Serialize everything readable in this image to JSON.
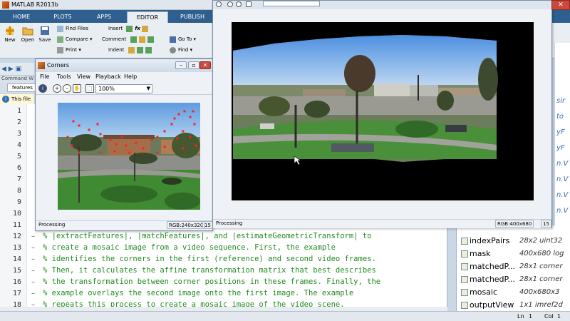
{
  "app": {
    "title": "MATLAB R2013b"
  },
  "tabs": [
    {
      "label": "HOME"
    },
    {
      "label": "PLOTS"
    },
    {
      "label": "APPS"
    },
    {
      "label": "EDITOR"
    },
    {
      "label": "PUBLISH"
    }
  ],
  "ribbon": {
    "new": "New",
    "open": "Open",
    "save": "Save",
    "find_files": "Find Files",
    "compare": "Compare",
    "print": "Print",
    "insert": "Insert",
    "comment": "Comment",
    "indent": "Indent",
    "go_to": "Go To",
    "find": "Find"
  },
  "left_panel": {
    "command_window_label": "Command W",
    "doc_tab": "features",
    "info_text": "This file c"
  },
  "editor": {
    "lines": [
      {
        "num": "1",
        "text": ""
      },
      {
        "num": "2",
        "text": ""
      },
      {
        "num": "3",
        "text": ""
      },
      {
        "num": "4",
        "text": ""
      },
      {
        "num": "5",
        "text": ""
      },
      {
        "num": "6",
        "text": ""
      },
      {
        "num": "7",
        "text": ""
      },
      {
        "num": "8",
        "text": ""
      },
      {
        "num": "9",
        "text": ""
      },
      {
        "num": "10",
        "text": ""
      },
      {
        "num": "11",
        "text": ""
      },
      {
        "num": "12",
        "text": "% |extractFeatures|, |matchFeatures|, and |estimateGeometricTransform| to"
      },
      {
        "num": "13",
        "text": "% create a mosaic image from a video sequence. First, the example"
      },
      {
        "num": "14",
        "text": "% identifies the corners in the first (reference) and second video frames."
      },
      {
        "num": "15",
        "text": "% Then, it calculates the affine transformation matrix that best describes"
      },
      {
        "num": "16",
        "text": "% the transformation between corner positions in these frames. Finally, the"
      },
      {
        "num": "17",
        "text": "% example overlays the second image onto the first image. The example"
      },
      {
        "num": "18",
        "text": "% repeats this process to create a mosaic image of the video scene."
      }
    ]
  },
  "workspace": {
    "rows": [
      {
        "name": "indexPairs",
        "value": "28x2 uint32"
      },
      {
        "name": "mask",
        "value": "400x680 log"
      },
      {
        "name": "matchedP...",
        "value": "28x1 corner"
      },
      {
        "name": "matchedP...",
        "value": "28x1 corner"
      },
      {
        "name": "mosaic",
        "value": "400x680x3"
      },
      {
        "name": "outputView",
        "value": "1x1 imref2d"
      }
    ],
    "right_strip": [
      "sir",
      "to",
      "yF",
      "yF",
      "n.V",
      "n.V",
      "n.V",
      "n.V"
    ]
  },
  "status": {
    "ln_label": "Ln",
    "ln": "1",
    "col_label": "Col",
    "col": "1"
  },
  "corners_window": {
    "title": "Corners",
    "menu": [
      "File",
      "Tools",
      "View",
      "Playback",
      "Help"
    ],
    "zoom": "100%",
    "status_left": "Processing",
    "status_res": "RGB:240x320",
    "status_frame": "15"
  },
  "mosaic_window": {
    "status_left": "Processing",
    "status_res": "RGB:400x680",
    "status_frame": "15"
  },
  "colors": {
    "tab_bar": "#2f5f8f",
    "comment_green": "#228b22",
    "corner_marker": "#ff2020"
  },
  "icons": [
    "new-icon",
    "open-icon",
    "save-icon",
    "info-icon",
    "zoom-in-icon",
    "zoom-out-icon",
    "pan-icon",
    "fit-icon",
    "close-icon"
  ]
}
